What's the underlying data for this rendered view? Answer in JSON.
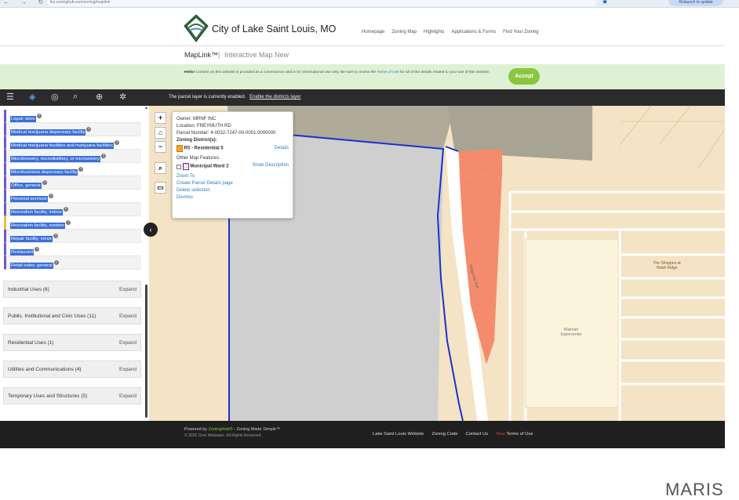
{
  "browser": {
    "url": "lks.zoninghub.com/zoning/maplink",
    "update_label": "Relaunch to update"
  },
  "header": {
    "site_title": "City of Lake Saint Louis, MO",
    "nav": [
      "Homepage",
      "Zoning Map",
      "Highlights",
      "Applications & Forms",
      "Find Your Zoning"
    ],
    "maplink_title": "MapLink™",
    "maplink_sep": "|",
    "maplink_subtitle": "Interactive Map New"
  },
  "notice": {
    "hello": "Hello!",
    "text": "Content on this website is provided as a convenience and is for informational use only. Be sure to review the",
    "link": "Terms of Use",
    "text2": "for all of the details related to your use of this website.",
    "accept_label": "Accept"
  },
  "toolbar": {
    "message": "The parcel layer is currently enabled.",
    "action": "Enable the districts layer"
  },
  "sidebar": {
    "uses": [
      {
        "label": "Liquor store",
        "color": "#6a5acd"
      },
      {
        "label": "Medical marijuana dispensary facility",
        "color": "#6a5acd"
      },
      {
        "label": "Medical marijuana facilities and marijuana facilities",
        "color": "#6a5acd"
      },
      {
        "label": "Microbrewery, microdistillery, or microwinery",
        "color": "#6a5acd"
      },
      {
        "label": "Microbusiness dispensary facility",
        "color": "#6a5acd"
      },
      {
        "label": "Office, general",
        "color": "#6a5acd"
      },
      {
        "label": "Personal services",
        "color": "#6a5acd"
      },
      {
        "label": "Recreation facility, indoor",
        "color": "#6a5acd"
      },
      {
        "label": "Recreation facility, outdoor",
        "color": "#e8c040"
      },
      {
        "label": "Repair facility, minor",
        "color": "#6a5acd"
      },
      {
        "label": "Restaurant",
        "color": "#6a5acd"
      },
      {
        "label": "Retail sales, general",
        "color": "#6a5acd"
      }
    ],
    "help_glyph": "?",
    "categories": [
      {
        "name": "Industrial Uses (6)",
        "expand": "Expand"
      },
      {
        "name": "Public, Institutional and Civic Uses (11)",
        "expand": "Expand"
      },
      {
        "name": "Residential Uses (1)",
        "expand": "Expand"
      },
      {
        "name": "Utilities and Communications (4)",
        "expand": "Expand"
      },
      {
        "name": "Temporary Uses and Structures (5)",
        "expand": "Expand"
      }
    ]
  },
  "map": {
    "controls": [
      "+",
      "⌂",
      "−",
      "⌕",
      "▭"
    ],
    "street_label": "Ridgeway Ave",
    "place1": "The Shoppes at Hawk Ridge",
    "place2": "Walmart Supercenter"
  },
  "popup": {
    "owner_label": "Owner:",
    "owner": "MRNF INC",
    "location_label": "Location:",
    "location": "FREYMUTH RD",
    "parcel_label": "Parcel Number:",
    "parcel": "4-0032-7247-00-0001.0000000",
    "zoning_label": "Zoning District(s):",
    "zoning": "R5 - Residential 5",
    "details": "Details",
    "other_label": "Other Map Features:",
    "feature": "Municipal Ward 2",
    "show_desc": "Show Description",
    "zoom": "Zoom To",
    "create": "Create Parcel Details page",
    "delete": "Delete selection",
    "dismiss": "Dismiss"
  },
  "footer": {
    "powered": "Powered by",
    "brand": "ZoningHub®",
    "tagline": "- Zoning Made Simple™",
    "copyright": "© 2025 Civic Webware. All Rights Reserved.",
    "links": [
      "Lake Saint Louis Website",
      "Zoning Code",
      "Contact Us"
    ],
    "new_badge": "New",
    "terms": "Terms of Use"
  },
  "watermark": "MARIS"
}
